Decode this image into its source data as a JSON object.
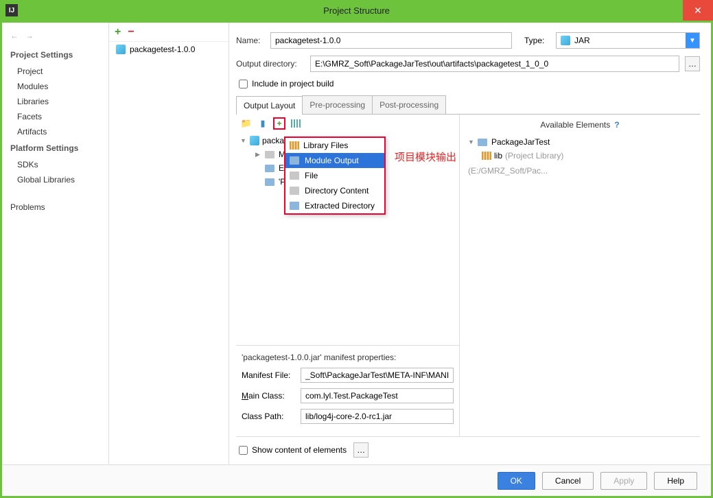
{
  "window": {
    "title": "Project Structure"
  },
  "sidebar": {
    "cat1": "Project Settings",
    "items1": [
      "Project",
      "Modules",
      "Libraries",
      "Facets",
      "Artifacts"
    ],
    "cat2": "Platform Settings",
    "items2": [
      "SDKs",
      "Global Libraries"
    ],
    "problems": "Problems"
  },
  "treePanel": {
    "node1": "packagetest-1.0.0"
  },
  "form": {
    "nameLabel": "Name:",
    "nameValue": "packagetest-1.0.0",
    "typeLabel": "Type:",
    "typeValue": "JAR",
    "outdirLabel": "Output directory:",
    "outdirValue": "E:\\GMRZ_Soft\\PackageJarTest\\out\\artifacts\\packagetest_1_0_0",
    "includeLabel": "Include in project build"
  },
  "tabs": {
    "t1": "Output Layout",
    "t2": "Pre-processing",
    "t3": "Post-processing"
  },
  "outputTree": {
    "root": "packagetest-1.0.0.jar",
    "n1": "META-INF",
    "n2": "Extracted ...",
    "n3": "'Packa..."
  },
  "popup": {
    "i1": "Library Files",
    "i2": "Module Output",
    "i3": "File",
    "i4": "Directory Content",
    "i5": "Extracted Directory"
  },
  "annotation": "项目模块输出",
  "available": {
    "header": "Available Elements",
    "root": "PackageJarTest",
    "lib": "lib",
    "libkind": "(Project Library)",
    "hint": "(E:/GMRZ_Soft/Pac..."
  },
  "manifest": {
    "header": "'packagetest-1.0.0.jar' manifest properties:",
    "fileLabel": "Manifest File:",
    "fileValue": "_Soft\\PackageJarTest\\META-INF\\MANIFEST",
    "mainLabel": "Main Class:",
    "mainValue": "com.lyl.Test.PackageTest",
    "cpLabel": "Class Path:",
    "cpValue": "lib/log4j-core-2.0-rc1.jar"
  },
  "showContent": "Show content of elements",
  "buttons": {
    "ok": "OK",
    "cancel": "Cancel",
    "apply": "Apply",
    "help": "Help"
  }
}
